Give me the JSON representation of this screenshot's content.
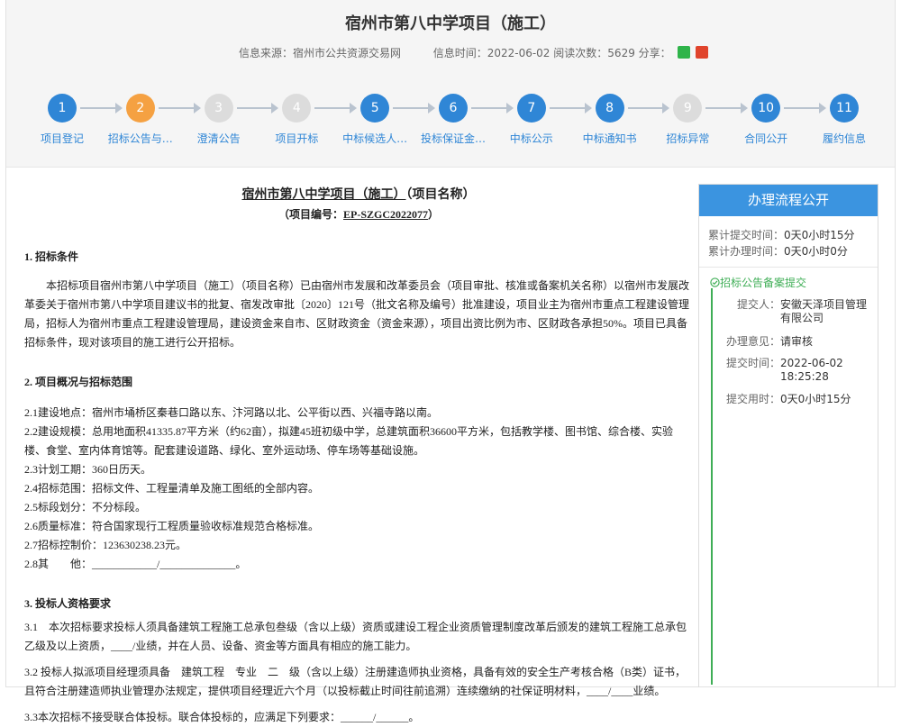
{
  "header": {
    "title": "宿州市第八中学项目（施工）",
    "source_label": "信息来源：",
    "source": "宿州市公共资源交易网",
    "time_label": "信息时间：",
    "time": "2022-06-02",
    "views_label": "阅读次数：",
    "views": "5629",
    "share_label": "分享："
  },
  "steps": [
    {
      "num": "1",
      "label": "项目登记",
      "state": "done"
    },
    {
      "num": "2",
      "label": "招标公告与…",
      "state": "current"
    },
    {
      "num": "3",
      "label": "澄清公告",
      "state": "pending"
    },
    {
      "num": "4",
      "label": "项目开标",
      "state": "pending"
    },
    {
      "num": "5",
      "label": "中标候选人…",
      "state": "done"
    },
    {
      "num": "6",
      "label": "投标保证金…",
      "state": "done"
    },
    {
      "num": "7",
      "label": "中标公示",
      "state": "done"
    },
    {
      "num": "8",
      "label": "中标通知书",
      "state": "done"
    },
    {
      "num": "9",
      "label": "招标异常",
      "state": "pending"
    },
    {
      "num": "10",
      "label": "合同公开",
      "state": "done"
    },
    {
      "num": "11",
      "label": "履约信息",
      "state": "done"
    }
  ],
  "doc": {
    "title_project": "宿州市第八中学项目（施工）",
    "title_suffix": "（项目名称）",
    "no_label": "（项目编号：",
    "no": "EP-SZGC2022077",
    "no_suffix": "）",
    "s1_title": "1. 招标条件",
    "s1_text": "本招标项目宿州市第八中学项目（施工）（项目名称）已由宿州市发展和改革委员会（项目审批、核准或备案机关名称）以宿州市发展改革委关于宿州市第八中学项目建议书的批复、宿发改审批〔2020〕121号（批文名称及编号）批准建设，项目业主为宿州市重点工程建设管理局，招标人为宿州市重点工程建设管理局，建设资金来自市、区财政资金（资金来源），项目出资比例为市、区财政各承担50%。项目已具备招标条件，现对该项目的施工进行公开招标。",
    "s2_title": "2. 项目概况与招标范围",
    "s2_items": [
      "2.1建设地点：宿州市埇桥区秦巷口路以东、汴河路以北、公平街以西、兴福寺路以南。",
      "2.2建设规模：总用地面积41335.87平方米（约62亩），拟建45班初级中学，总建筑面积36600平方米，包括教学楼、图书馆、综合楼、实验楼、食堂、室内体育馆等。配套建设道路、绿化、室外运动场、停车场等基础设施。",
      "2.3计划工期：360日历天。",
      "2.4招标范围：招标文件、工程量清单及施工图纸的全部内容。",
      "2.5标段划分：不分标段。",
      "2.6质量标准：符合国家现行工程质量验收标准规范合格标准。",
      "2.7招标控制价：123630238.23元。",
      "2.8其　　他：____________/______________。"
    ],
    "s3_title": "3. 投标人资格要求",
    "s3_items": [
      "3.1　本次招标要求投标人须具备建筑工程施工总承包叁级（含以上级）资质或建设工程企业资质管理制度改革后颁发的建筑工程施工总承包乙级及以上资质，____/业绩，并在人员、设备、资金等方面具有相应的施工能力。",
      "3.2 投标人拟派项目经理须具备　建筑工程　专业　二　级（含以上级）注册建造师执业资格，具备有效的安全生产考核合格（B类）证书，且符合注册建造师执业管理办法规定，提供项目经理近六个月（以投标截止时间往前追溯）连续缴纳的社保证明材料，____/____业绩。",
      "3.3本次招标不接受联合体投标。联合体投标的，应满足下列要求：______/______。"
    ]
  },
  "side": {
    "title": "办理流程公开",
    "submit_time_label": "累计提交时间：",
    "submit_time": "0天0小时15分",
    "handle_time_label": "累计办理时间：",
    "handle_time": "0天0小时0分",
    "record_title": "招标公告备案提交",
    "submitter_label": "提交人：",
    "submitter": "安徽天泽项目管理有限公司",
    "opinion_label": "办理意见：",
    "opinion": "请审核",
    "time_label": "提交时间：",
    "time": "2022-06-02 18:25:28",
    "duration_label": "提交用时：",
    "duration": "0天0小时15分"
  },
  "colors": {
    "primary": "#2f86d6",
    "current": "#f5a142",
    "pending": "#dcdcdc",
    "success": "#3fae56"
  }
}
